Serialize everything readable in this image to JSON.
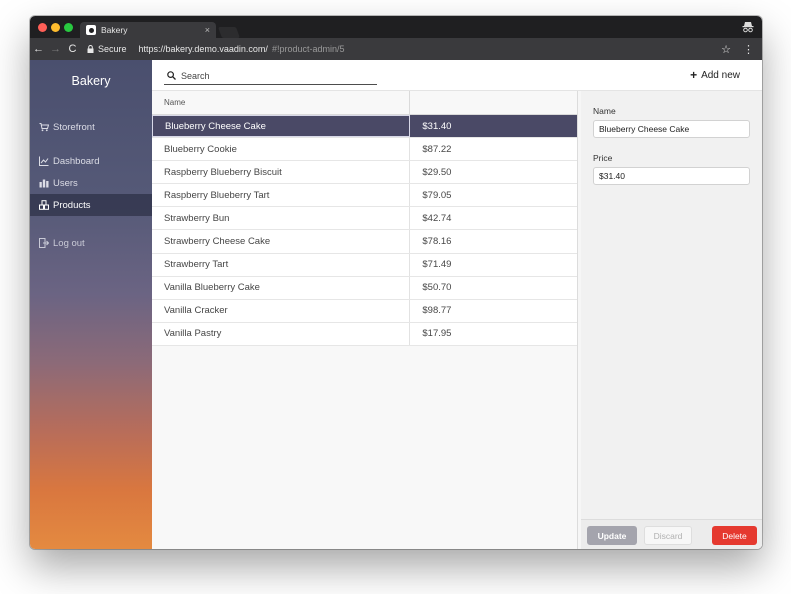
{
  "browser": {
    "tab_title": "Bakery",
    "tab_close": "×",
    "secure_label": "Secure",
    "url_host": "https://bakery.demo.vaadin.com/",
    "url_path": "#!product-admin/5",
    "back": "←",
    "forward": "→",
    "reload": "C",
    "star": "☆",
    "menu": "⋮"
  },
  "sidebar": {
    "title": "Bakery",
    "items": [
      {
        "label": "Storefront",
        "icon": "cart-icon"
      },
      {
        "label": "Dashboard",
        "icon": "chart-icon"
      },
      {
        "label": "Users",
        "icon": "users-icon"
      },
      {
        "label": "Products",
        "icon": "products-icon",
        "active": true
      },
      {
        "label": "Log out",
        "icon": "logout-icon"
      }
    ]
  },
  "toolbar": {
    "search_placeholder": "Search",
    "add_new_label": "Add new"
  },
  "grid": {
    "header_name": "Name",
    "header_price": "",
    "rows": [
      {
        "name": "Blueberry Cheese Cake",
        "price": "$31.40",
        "selected": true
      },
      {
        "name": "Blueberry Cookie",
        "price": "$87.22"
      },
      {
        "name": "Raspberry Blueberry Biscuit",
        "price": "$29.50"
      },
      {
        "name": "Raspberry Blueberry Tart",
        "price": "$79.05"
      },
      {
        "name": "Strawberry Bun",
        "price": "$42.74"
      },
      {
        "name": "Strawberry Cheese Cake",
        "price": "$78.16"
      },
      {
        "name": "Strawberry Tart",
        "price": "$71.49"
      },
      {
        "name": "Vanilla Blueberry Cake",
        "price": "$50.70"
      },
      {
        "name": "Vanilla Cracker",
        "price": "$98.77"
      },
      {
        "name": "Vanilla Pastry",
        "price": "$17.95"
      }
    ]
  },
  "form": {
    "name_label": "Name",
    "name_value": "Blueberry Cheese Cake",
    "price_label": "Price",
    "price_value": "$31.40",
    "update_label": "Update",
    "discard_label": "Discard",
    "delete_label": "Delete"
  },
  "colors": {
    "selected_row": "#4a4966",
    "delete": "#e5392f",
    "update": "#a4a4ad"
  }
}
